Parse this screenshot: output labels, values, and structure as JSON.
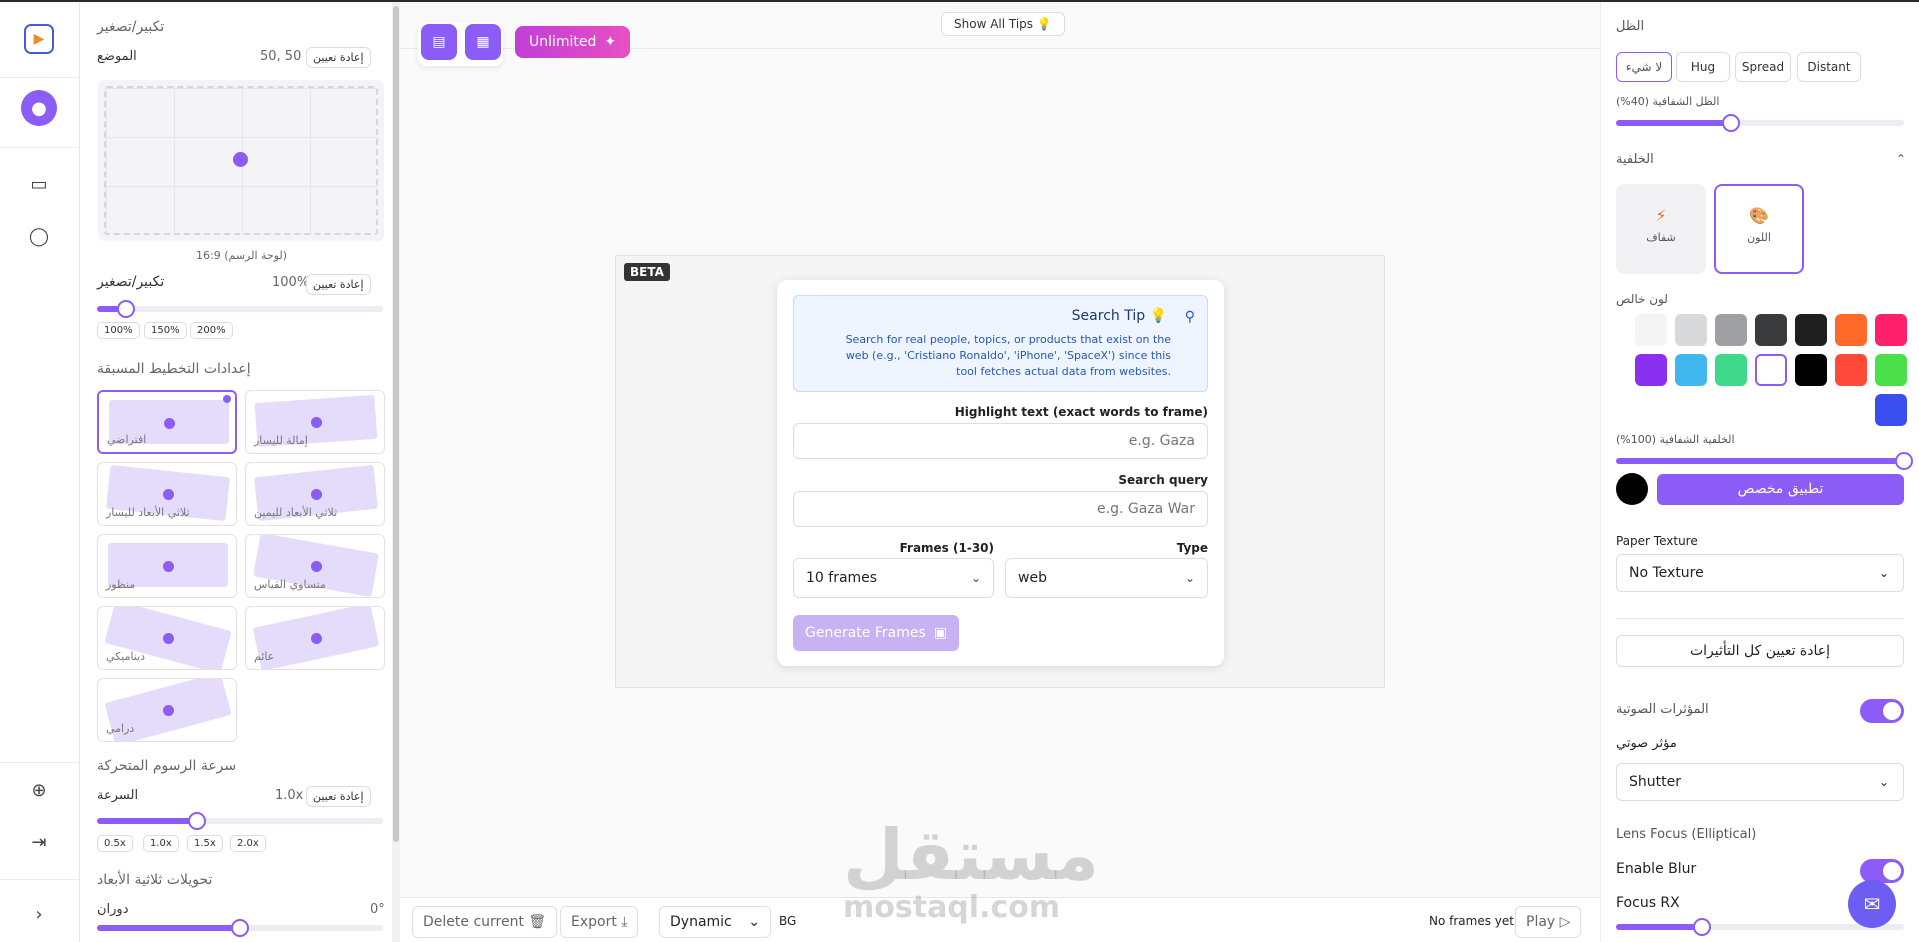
{
  "left_panel": {
    "zoom_section_title": "تكبير/تصغير",
    "position_label": "الموضع",
    "position_value": "50, 50",
    "reset_label": "إعادة تعيين",
    "canvas_ratio_label": "16:9 (لوحة الرسم)",
    "zoom_label": "تكبير/تصغير",
    "zoom_value": "100%",
    "zoom_level": 0.1,
    "zoom_chips": [
      "100%",
      "150%",
      "200%"
    ],
    "presets_title": "إعدادات التخطيط المسبقة",
    "presets": [
      {
        "label": "إمالة لليسار",
        "selected": false
      },
      {
        "label": "افتراضي",
        "selected": true
      },
      {
        "label": "ثلاثي الأبعاد لليمين",
        "selected": false
      },
      {
        "label": "ثلاثي الأبعاد لليسار",
        "selected": false
      },
      {
        "label": "متساوي القياس",
        "selected": false
      },
      {
        "label": "منظور",
        "selected": false
      },
      {
        "label": "عائم",
        "selected": false
      },
      {
        "label": "ديناميكي",
        "selected": false
      },
      {
        "label": "درامي",
        "selected": false
      }
    ],
    "animation_speed_title": "سرعة الرسوم المتحركة",
    "speed_label": "السرعة",
    "speed_value": "1.0x",
    "speed_level": 0.35,
    "speed_chips": [
      "0.5x",
      "1.0x",
      "1.5x",
      "2.0x"
    ],
    "transform3d_title": "تحويلات ثلاثية الأبعاد",
    "rotation_label": "دوران",
    "rotation_value": "0°",
    "rotation_level": 0.5
  },
  "canvas": {
    "show_tips_label": "Show All Tips 💡",
    "unlimited_label": "Unlimited",
    "beta_label": "BETA",
    "tip_title": "Search Tip 💡",
    "tip_body": "Search for real people, topics, or products that exist on the web (e.g., 'Cristiano Ronaldo', 'iPhone', 'SpaceX') since this tool fetches actual data from websites.",
    "highlight_label": "Highlight text (exact words to frame)",
    "highlight_placeholder": "e.g. Gaza",
    "query_label": "Search query",
    "query_placeholder": "e.g. Gaza War",
    "frames_label": "Frames (1-30)",
    "frames_value": "10 frames",
    "type_label": "Type",
    "type_value": "web",
    "generate_label": "Generate Frames",
    "bottom": {
      "delete_label": "Delete current",
      "export_label": "Export",
      "mode_value": "Dynamic",
      "bg_label": "BG",
      "no_frames_label": "No frames yet",
      "play_label": "Play"
    }
  },
  "right_panel": {
    "shadow_title": "الظل",
    "shadow_options": [
      {
        "label": "Distant",
        "on": false
      },
      {
        "label": "Spread",
        "on": false
      },
      {
        "label": "Hug",
        "on": false
      },
      {
        "label": "لا شيء",
        "on": true
      }
    ],
    "shadow_opacity_label": "الظل الشفافية (40%)",
    "shadow_opacity_level": 0.4,
    "background_title": "الخلفية",
    "bg_color_label": "اللون",
    "bg_transparent_label": "شفاف",
    "solid_color_label": "لون خالص",
    "swatches": [
      "#ff1f6b",
      "#ff6a2a",
      "#1f1f1f",
      "#3a3b3d",
      "#9fa0a4",
      "#d8d9db",
      "#f4f4f5",
      "#4ae04a",
      "#ff4a3a",
      "#000000",
      "#ffffff",
      "#3fd98a",
      "#42b6ee",
      "#8b2ff0",
      "#3a4ef0"
    ],
    "bg_opacity_label": "الخلفية الشفافية (100%)",
    "bg_opacity_level": 1.0,
    "apply_custom_label": "تطبيق مخصص",
    "custom_color": "#000000",
    "paper_texture_label": "Paper Texture",
    "paper_texture_value": "No Texture",
    "reset_all_label": "إعادة تعيين كل التأثيرات",
    "sound_effects_label": "المؤثرات الصوتية",
    "sound_effect_label": "مؤثر صوتي",
    "sound_effect_value": "Shutter",
    "lens_focus_label": "Lens Focus (Elliptical)",
    "enable_blur_label": "Enable Blur",
    "focus_rx_label": "Focus RX",
    "focus_rx_level": 0.3
  },
  "watermark": {
    "arabic": "مستقل",
    "latin": "mostaql.com"
  },
  "accent": "#8b5cf6"
}
